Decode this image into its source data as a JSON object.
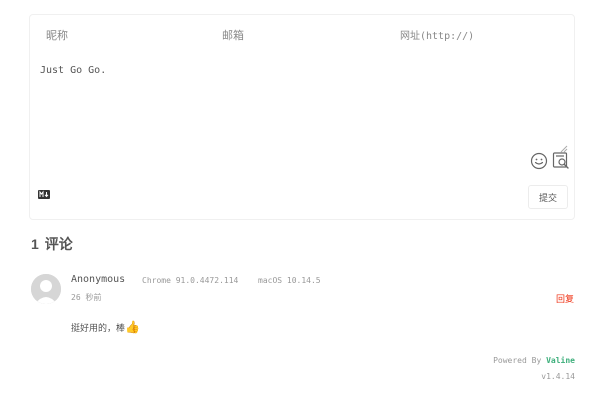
{
  "form": {
    "nick_placeholder": "昵称",
    "mail_placeholder": "邮箱",
    "link_placeholder": "网址(http://)",
    "editor_value": "Just Go Go.",
    "submit_label": "提交"
  },
  "icons": {
    "emoji": "smile-icon",
    "preview": "preview-icon",
    "markdown": "markdown-icon"
  },
  "comments_header": {
    "count": "1",
    "label": "评论"
  },
  "comments": [
    {
      "nick": "Anonymous",
      "browser": "Chrome 91.0.4472.114",
      "os": "macOS 10.14.5",
      "time": "26 秒前",
      "reply_label": "回复",
      "content": "挺好用的，棒",
      "emoji": "👍"
    }
  ],
  "footer": {
    "powered_prefix": "Powered By",
    "brand": "Valine",
    "version": "v1.4.14"
  },
  "colors": {
    "accent": "#3eaf7c",
    "reply": "#ef2f11",
    "border": "#f0f0f0"
  }
}
